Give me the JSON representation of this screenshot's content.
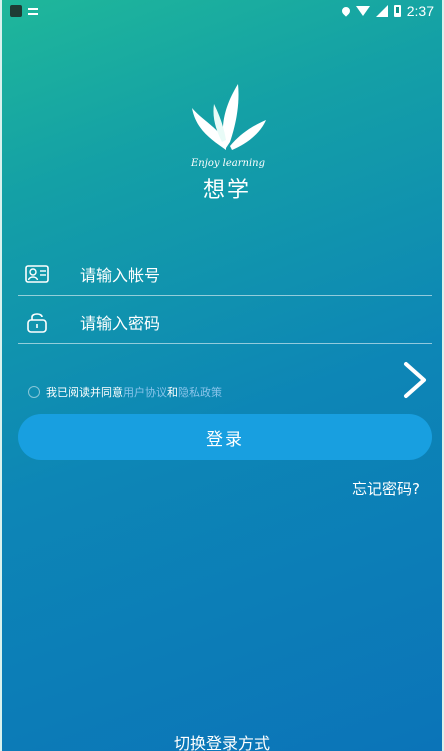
{
  "status_bar": {
    "time": "2:37",
    "icons": [
      "app-icon",
      "notification-icon",
      "location-icon",
      "wifi-icon",
      "signal-icon",
      "battery-icon"
    ]
  },
  "brand": {
    "tagline": "Enjoy learning",
    "name": "想学"
  },
  "form": {
    "account_placeholder": "请输入帐号",
    "password_placeholder": "请输入密码",
    "account_icon": "id-card-icon",
    "password_icon": "lock-icon"
  },
  "agreement": {
    "prefix": "我已阅读并同意",
    "user_agreement": "用户协议",
    "and": "和",
    "privacy_policy": "隐私政策"
  },
  "actions": {
    "login": "登录",
    "forgot_password": "忘记密码?",
    "switch_login": "切换登录方式"
  },
  "colors": {
    "gradient_top": "#1fb79a",
    "gradient_bottom": "#0b74b8",
    "button": "#189fe0",
    "link": "#89c4ea"
  }
}
